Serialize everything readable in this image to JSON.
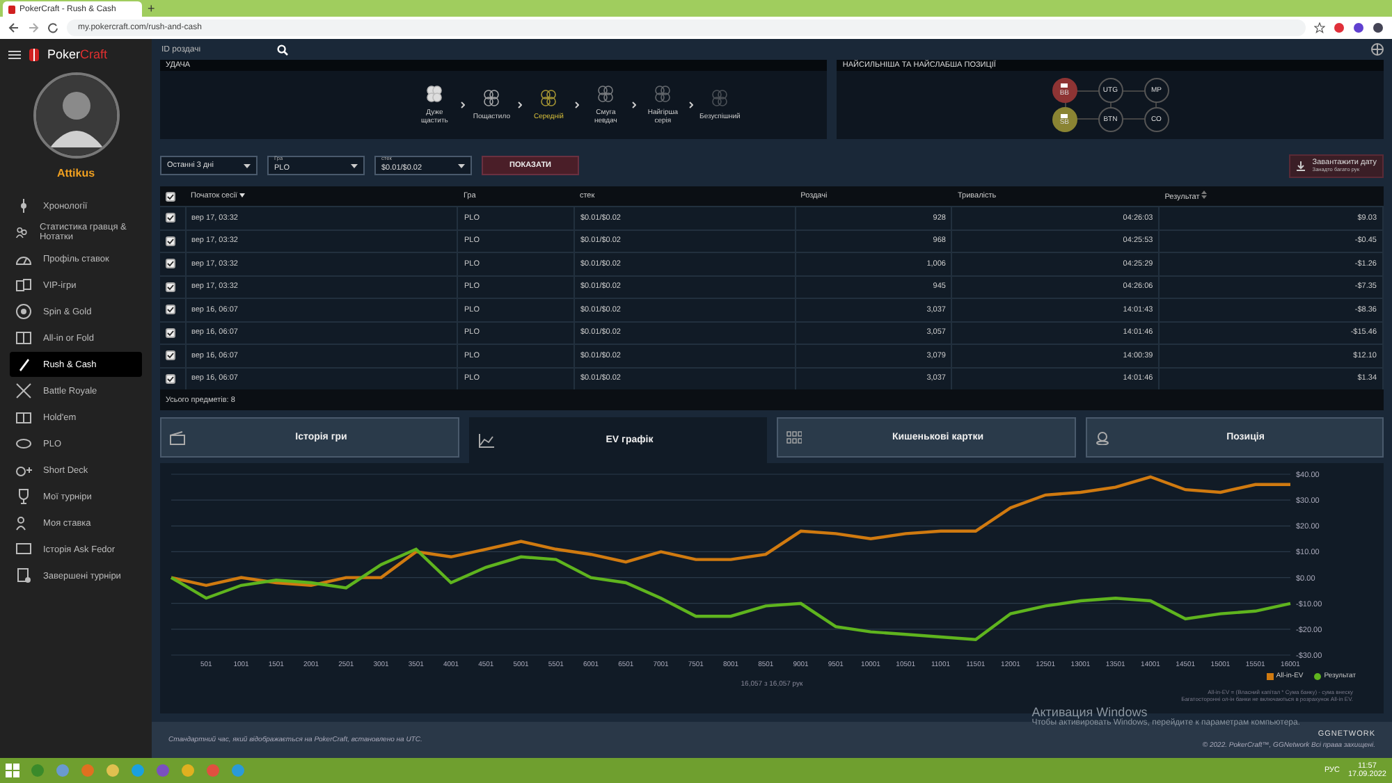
{
  "browser": {
    "tab_title": "PokerCraft - Rush & Cash",
    "new_tab": "+",
    "url": "my.pokercraft.com/rush-and-cash"
  },
  "sidebar": {
    "logo_left": "Poker",
    "logo_right": "Craft",
    "username": "Attikus",
    "items": [
      {
        "label": "Хронології",
        "selected": false
      },
      {
        "label": "Статистика гравця & Нотатки",
        "selected": false
      },
      {
        "label": "Профіль ставок",
        "selected": false
      },
      {
        "label": "VIP-ігри",
        "selected": false
      },
      {
        "label": "Spin & Gold",
        "selected": false
      },
      {
        "label": "All-in or Fold",
        "selected": false
      },
      {
        "label": "Rush & Cash",
        "selected": true
      },
      {
        "label": "Battle Royale",
        "selected": false
      },
      {
        "label": "Hold'em",
        "selected": false
      },
      {
        "label": "PLO",
        "selected": false
      },
      {
        "label": "Short Deck",
        "selected": false
      },
      {
        "label": "Мої турніри",
        "selected": false
      },
      {
        "label": "Моя ставка",
        "selected": false
      },
      {
        "label": "Історія Ask Fedor",
        "selected": false
      },
      {
        "label": "Завершені турніри",
        "selected": false
      }
    ]
  },
  "search": {
    "placeholder": "ID роздачі"
  },
  "luck": {
    "title": "УДАЧА",
    "steps": [
      {
        "label": "Дуже щастить",
        "selected": false
      },
      {
        "label": "Пощастило",
        "selected": false
      },
      {
        "label": "Середній",
        "selected": true
      },
      {
        "label": "Смуга невдач",
        "selected": false
      },
      {
        "label": "Найгірша серія",
        "selected": false
      },
      {
        "label": "Безуспішний",
        "selected": false
      }
    ]
  },
  "positions": {
    "title": "НАЙСИЛЬНІША ТА НАЙСЛАБША ПОЗИЦІЇ",
    "items": [
      {
        "label": "BB",
        "kind": "worst"
      },
      {
        "label": "UTG",
        "kind": "normal"
      },
      {
        "label": "MP",
        "kind": "normal"
      },
      {
        "label": "SB",
        "kind": "best"
      },
      {
        "label": "BTN",
        "kind": "normal"
      },
      {
        "label": "CO",
        "kind": "normal"
      }
    ]
  },
  "filters": {
    "period": "Останні 3 дні",
    "game_label": "Гра",
    "game": "PLO",
    "stake_label": "стек",
    "stake": "$0.01/$0.02",
    "show_button": "ПОКАЗАТИ",
    "download_title": "Завантажити",
    "download_suffix": "дату",
    "download_note": "Занадто багато рук"
  },
  "table": {
    "columns": [
      {
        "label": "Початок сесії",
        "sorted": true,
        "sortable": false
      },
      {
        "label": "Гра",
        "sorted": false,
        "sortable": false
      },
      {
        "label": "стек",
        "sorted": false,
        "sortable": false
      },
      {
        "label": "Роздачі",
        "sorted": false,
        "sortable": false
      },
      {
        "label": "Тривалість",
        "sorted": false,
        "sortable": false
      },
      {
        "label": "Результат",
        "sorted": false,
        "sortable": true
      }
    ],
    "all_checked": true,
    "rows": [
      {
        "checked": true,
        "cells": [
          "вер 17, 03:32",
          "PLO",
          "$0.01/$0.02",
          "928",
          "04:26:03",
          "$9.03"
        ]
      },
      {
        "checked": true,
        "cells": [
          "вер 17, 03:32",
          "PLO",
          "$0.01/$0.02",
          "968",
          "04:25:53",
          "-$0.45"
        ]
      },
      {
        "checked": true,
        "cells": [
          "вер 17, 03:32",
          "PLO",
          "$0.01/$0.02",
          "1,006",
          "04:25:29",
          "-$1.26"
        ]
      },
      {
        "checked": true,
        "cells": [
          "вер 17, 03:32",
          "PLO",
          "$0.01/$0.02",
          "945",
          "04:26:06",
          "-$7.35"
        ]
      },
      {
        "checked": true,
        "cells": [
          "вер 16, 06:07",
          "PLO",
          "$0.01/$0.02",
          "3,037",
          "14:01:43",
          "-$8.36"
        ]
      },
      {
        "checked": true,
        "cells": [
          "вер 16, 06:07",
          "PLO",
          "$0.01/$0.02",
          "3,057",
          "14:01:46",
          "-$15.46"
        ]
      },
      {
        "checked": true,
        "cells": [
          "вер 16, 06:07",
          "PLO",
          "$0.01/$0.02",
          "3,079",
          "14:00:39",
          "$12.10"
        ]
      },
      {
        "checked": true,
        "cells": [
          "вер 16, 06:07",
          "PLO",
          "$0.01/$0.02",
          "3,037",
          "14:01:46",
          "$1.34"
        ]
      }
    ],
    "total": "Усього предметів: 8"
  },
  "tabs": [
    {
      "label": "Історія гри",
      "selected": false
    },
    {
      "label": "EV графік",
      "selected": true
    },
    {
      "label": "Кишенькові картки",
      "selected": false
    },
    {
      "label": "Позиція",
      "selected": false
    }
  ],
  "chart_data": {
    "type": "line",
    "grid": true,
    "x": [
      1,
      501,
      1001,
      1501,
      2001,
      2501,
      3001,
      3501,
      4001,
      4501,
      5001,
      5501,
      6001,
      6501,
      7001,
      7501,
      8001,
      8501,
      9001,
      9501,
      10001,
      10501,
      11001,
      11501,
      12001,
      12501,
      13001,
      13501,
      14001,
      14501,
      15001,
      15501,
      16001
    ],
    "series": [
      {
        "name": "All-in-EV",
        "color": "#d07a10",
        "values": [
          0,
          -3,
          0,
          -2,
          -3,
          0,
          0,
          10,
          8,
          11,
          14,
          11,
          9,
          6,
          10,
          7,
          7,
          9,
          18,
          17,
          15,
          17,
          18,
          18,
          27,
          32,
          33,
          35,
          39,
          34,
          33,
          36,
          36
        ]
      },
      {
        "name": "Результат",
        "color": "#5fb41e",
        "values": [
          0,
          -8,
          -3,
          -1,
          -2,
          -4,
          5,
          11,
          -2,
          4,
          8,
          7,
          0,
          -2,
          -8,
          -15,
          -15,
          -11,
          -10,
          -19,
          -21,
          -22,
          -23,
          -24,
          -14,
          -11,
          -9,
          -8,
          -9,
          -16,
          -14,
          -13,
          -10
        ]
      }
    ],
    "xlim": [
      1,
      16001
    ],
    "ylim": [
      -30,
      40
    ],
    "xticks": [
      501,
      1001,
      1501,
      2001,
      2501,
      3001,
      3501,
      4001,
      4501,
      5001,
      5501,
      6001,
      6501,
      7001,
      7501,
      8001,
      8501,
      9001,
      9501,
      10001,
      10501,
      11001,
      11501,
      12001,
      12501,
      13001,
      13501,
      14001,
      14501,
      15001,
      15501,
      16001
    ],
    "yticks": [
      {
        "value": -30,
        "label": "-$30.00"
      },
      {
        "value": -20,
        "label": "-$20.00"
      },
      {
        "value": -10,
        "label": "-$10.00"
      },
      {
        "value": 0,
        "label": "$0.00"
      },
      {
        "value": 10,
        "label": "$10.00"
      },
      {
        "value": 20,
        "label": "$20.00"
      },
      {
        "value": 30,
        "label": "$30.00"
      },
      {
        "value": 40,
        "label": "$40.00"
      }
    ]
  },
  "chart_caption": "16,057 з 16,057 рук",
  "chart_notes": [
    "All-in-EV = (Власний капітал * Сума банку) - сума внеску",
    "Багатосторонні ол-ін банки не включаються в розрахунок All-in EV."
  ],
  "windows_notice": {
    "title": "Активация Windows",
    "text": "Чтобы активировать Windows, перейдите к параметрам компьютера."
  },
  "footer": {
    "timezone": "Стандартний час, який відображається на *PokerCraft*, встановлено на *UTC*.",
    "brand": "GGNETWORK",
    "copyright": "© 2022. PokerCraft™, GGNetwork Всі права захищені."
  },
  "taskbar": {
    "language": "РУС",
    "time": "11:57",
    "date": "17.09.2022"
  }
}
